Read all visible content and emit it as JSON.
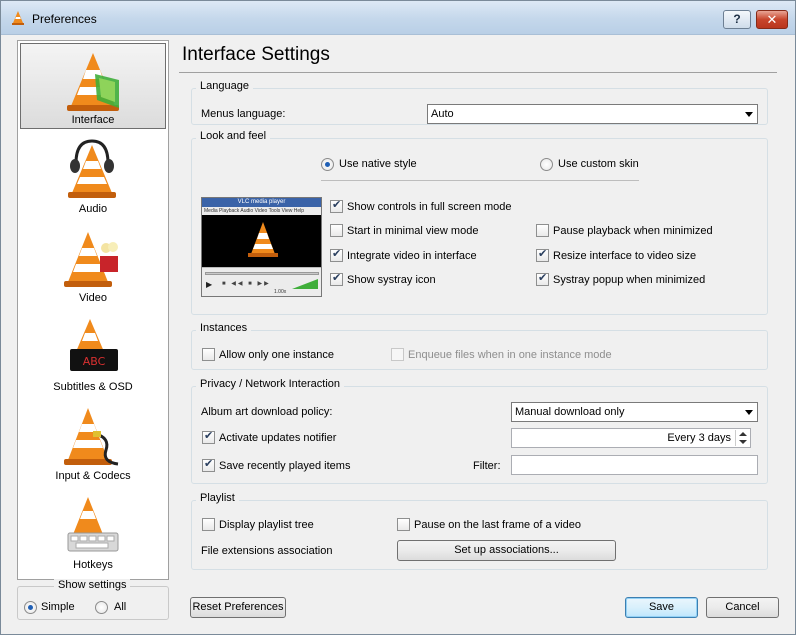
{
  "window": {
    "title": "Preferences",
    "help_label": "?",
    "close_label": "✕"
  },
  "sidebar": {
    "items": [
      {
        "label": "Interface",
        "icon": "interface-cone-icon"
      },
      {
        "label": "Audio",
        "icon": "audio-cone-icon"
      },
      {
        "label": "Video",
        "icon": "video-cone-icon"
      },
      {
        "label": "Subtitles & OSD",
        "icon": "subtitles-cone-icon"
      },
      {
        "label": "Input & Codecs",
        "icon": "input-cone-icon"
      },
      {
        "label": "Hotkeys",
        "icon": "hotkeys-cone-icon"
      }
    ],
    "show_settings": {
      "legend": "Show settings",
      "simple": "Simple",
      "all": "All",
      "selected": "Simple"
    }
  },
  "page": {
    "title": "Interface Settings"
  },
  "language": {
    "legend": "Language",
    "menus_label": "Menus language:",
    "menus_value": "Auto"
  },
  "look": {
    "legend": "Look and feel",
    "native_style": "Use native style",
    "custom_skin": "Use custom skin",
    "preview_title": "VLC media player",
    "preview_menu": "Media Playback Audio Video Tools View Help",
    "preview_zoom": "1.00x",
    "options": {
      "full_screen_controls": {
        "label": "Show controls in full screen mode",
        "checked": true
      },
      "minimal_view": {
        "label": "Start in minimal view mode",
        "checked": false
      },
      "pause_minimized": {
        "label": "Pause playback when minimized",
        "checked": false
      },
      "integrate_video": {
        "label": "Integrate video in interface",
        "checked": true
      },
      "resize_interface": {
        "label": "Resize interface to video size",
        "checked": true
      },
      "systray_icon": {
        "label": "Show systray icon",
        "checked": true
      },
      "systray_popup": {
        "label": "Systray popup when minimized",
        "checked": true
      }
    }
  },
  "instances": {
    "legend": "Instances",
    "one_instance": "Allow only one instance",
    "enqueue": "Enqueue files when in one instance mode"
  },
  "privacy": {
    "legend": "Privacy / Network Interaction",
    "album_art_label": "Album art download policy:",
    "album_art_value": "Manual download only",
    "updates_label": "Activate updates notifier",
    "updates_interval": "Every 3 days",
    "recent_label": "Save recently played items",
    "filter_label": "Filter:",
    "filter_value": ""
  },
  "playlist": {
    "legend": "Playlist",
    "display_tree": "Display playlist tree",
    "pause_last_frame": "Pause on the last frame of a video",
    "file_ext_label": "File extensions association",
    "setup_button": "Set up associations..."
  },
  "footer": {
    "reset": "Reset Preferences",
    "save": "Save",
    "cancel": "Cancel"
  },
  "colors": {
    "cone_orange": "#f08a1c",
    "accent_blue": "#3c7fb1"
  }
}
